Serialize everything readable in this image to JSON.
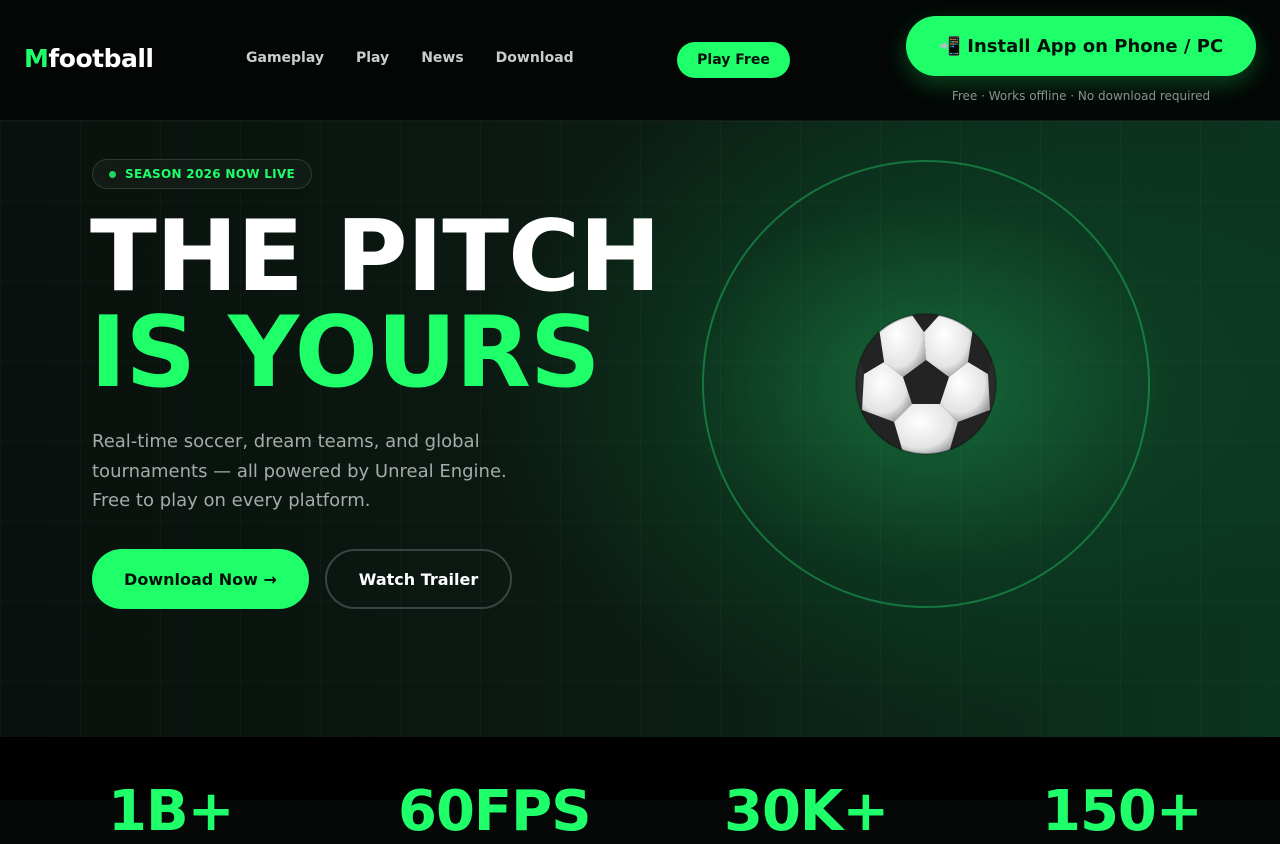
{
  "header": {
    "logo_accent": "M",
    "logo_rest": "football",
    "nav": [
      "Gameplay",
      "Play",
      "News",
      "Download"
    ],
    "play_free": "Play Free",
    "install_icon": "📲",
    "install_label": "Install App on Phone / PC",
    "install_note": "Free · Works offline · No download required"
  },
  "hero": {
    "badge": "SEASON 2026 NOW LIVE",
    "headline_line1": "THE PITCH",
    "headline_line2": "IS YOURS",
    "subtext": "Real-time soccer, dream teams, and global tournaments — all powered by Unreal Engine. Free to play on every platform.",
    "download_button": "Download Now →",
    "trailer_button": "Watch Trailer",
    "visual_icon": "soccer-ball-icon"
  },
  "stats": [
    "1B+",
    "60FPS",
    "30K+",
    "150+"
  ],
  "colors": {
    "accent": "#1fff6a",
    "background": "#050807",
    "hero_glow": "#0c3420"
  }
}
